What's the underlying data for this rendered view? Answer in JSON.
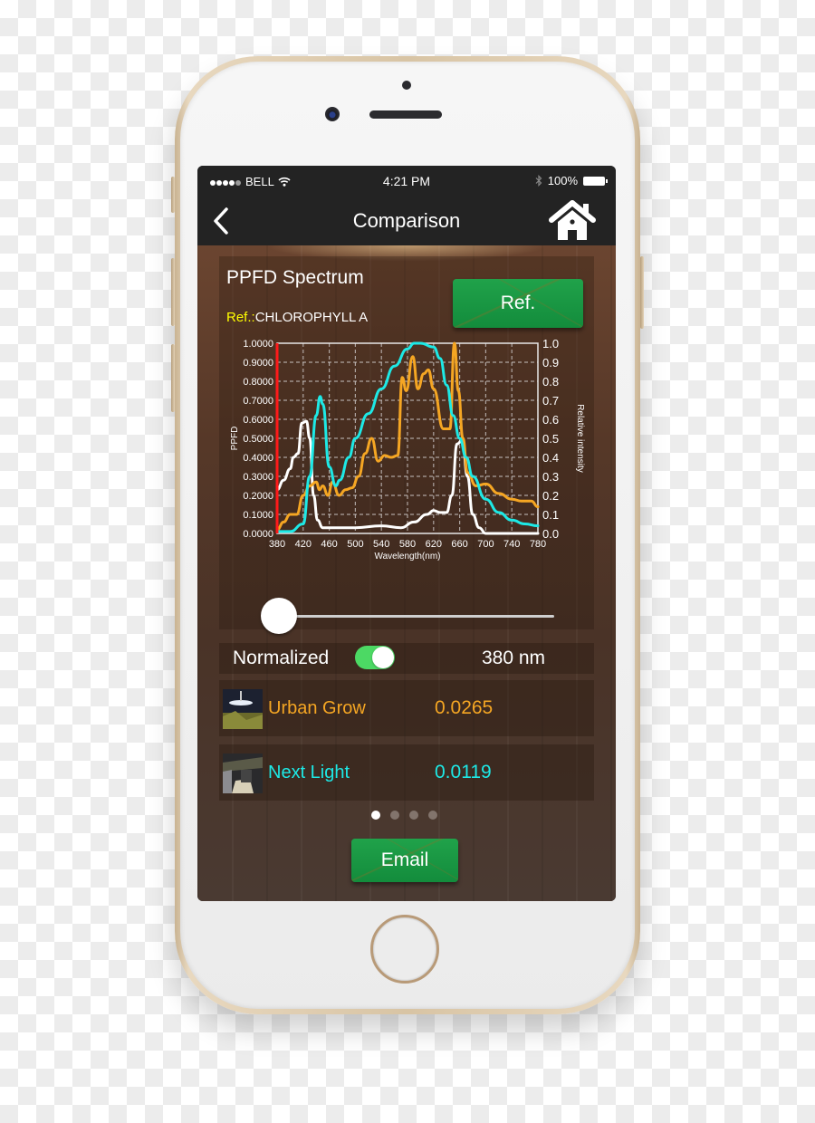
{
  "status_bar": {
    "carrier": "BELL",
    "time": "4:21 PM",
    "battery": "100%",
    "signal_icon": "signal-dots-icon",
    "wifi_icon": "wifi-icon",
    "bluetooth_icon": "bluetooth-icon",
    "battery_icon": "battery-icon"
  },
  "nav": {
    "title": "Comparison",
    "back_icon": "chevron-left-icon",
    "home_icon": "home-icon"
  },
  "spectrum": {
    "title": "PPFD Spectrum",
    "ref_key": "Ref.:",
    "ref_value": "CHLOROPHYLL A",
    "ref_button": "Ref."
  },
  "chart_data": {
    "type": "line",
    "title": "",
    "xlabel": "Wavelength(nm)",
    "ylabel": "PPFD",
    "y2label": "Relative intensity",
    "xlim": [
      380,
      780
    ],
    "ylim": [
      0,
      1
    ],
    "y2lim": [
      0,
      1
    ],
    "grid": true,
    "x_ticks": [
      "380",
      "420",
      "460",
      "500",
      "540",
      "580",
      "620",
      "660",
      "700",
      "740",
      "780"
    ],
    "y_ticks": [
      "0.0000",
      "0.1000",
      "0.2000",
      "0.3000",
      "0.4000",
      "0.5000",
      "0.6000",
      "0.7000",
      "0.8000",
      "0.9000",
      "1.0000"
    ],
    "y2_ticks": [
      "0.0",
      "0.1",
      "0.2",
      "0.3",
      "0.4",
      "0.5",
      "0.6",
      "0.7",
      "0.8",
      "0.9",
      "1.0"
    ],
    "cursor_nm": 380,
    "cursor_color": "#ff1a1a",
    "series": [
      {
        "name": "Chlorophyll A (Ref.)",
        "color": "#ffffff",
        "x": [
          380,
          390,
          400,
          405,
          412,
          418,
          425,
          430,
          436,
          442,
          450,
          480,
          500,
          540,
          570,
          590,
          610,
          620,
          630,
          640,
          648,
          656,
          664,
          672,
          680,
          690,
          700,
          780
        ],
        "y": [
          0.23,
          0.28,
          0.34,
          0.4,
          0.42,
          0.58,
          0.59,
          0.5,
          0.2,
          0.07,
          0.03,
          0.03,
          0.03,
          0.04,
          0.03,
          0.06,
          0.1,
          0.12,
          0.11,
          0.11,
          0.2,
          0.47,
          0.49,
          0.3,
          0.1,
          0.03,
          0.0,
          0.0
        ]
      },
      {
        "name": "Urban Grow",
        "color": "#f5a623",
        "x": [
          380,
          390,
          400,
          410,
          420,
          430,
          440,
          445,
          450,
          458,
          465,
          475,
          485,
          495,
          505,
          515,
          525,
          535,
          545,
          555,
          565,
          572,
          578,
          588,
          596,
          605,
          612,
          620,
          635,
          645,
          652,
          658,
          665,
          672,
          685,
          700,
          720,
          740,
          755,
          770,
          780
        ],
        "y": [
          0.02,
          0.06,
          0.1,
          0.1,
          0.2,
          0.25,
          0.27,
          0.23,
          0.25,
          0.2,
          0.27,
          0.2,
          0.23,
          0.24,
          0.3,
          0.42,
          0.5,
          0.38,
          0.41,
          0.4,
          0.41,
          0.82,
          0.75,
          0.93,
          0.76,
          0.84,
          0.86,
          0.76,
          0.55,
          0.55,
          1.0,
          0.75,
          0.5,
          0.32,
          0.25,
          0.26,
          0.21,
          0.18,
          0.17,
          0.17,
          0.14
        ]
      },
      {
        "name": "Next Light",
        "color": "#1de9e6",
        "x": [
          380,
          400,
          420,
          430,
          440,
          446,
          450,
          460,
          470,
          476,
          490,
          500,
          520,
          540,
          560,
          580,
          590,
          600,
          620,
          630,
          640,
          650,
          660,
          670,
          680,
          700,
          720,
          740,
          760,
          780
        ],
        "y": [
          0.01,
          0.01,
          0.05,
          0.3,
          0.62,
          0.72,
          0.68,
          0.35,
          0.25,
          0.28,
          0.4,
          0.5,
          0.63,
          0.76,
          0.88,
          0.97,
          1.0,
          1.0,
          0.98,
          0.92,
          0.78,
          0.62,
          0.5,
          0.4,
          0.3,
          0.18,
          0.11,
          0.07,
          0.05,
          0.04
        ]
      }
    ]
  },
  "slider": {
    "value_nm": 380,
    "min_nm": 380,
    "max_nm": 780
  },
  "normalized": {
    "label": "Normalized",
    "on": true,
    "wavelength_readout": "380 nm"
  },
  "lights": [
    {
      "name": "Urban Grow",
      "value": "0.0265",
      "color": "#f5a623"
    },
    {
      "name": "Next Light",
      "value": "0.0119",
      "color": "#1de9e6"
    }
  ],
  "pager": {
    "pages": 4,
    "active": 0
  },
  "email_button": "Email"
}
